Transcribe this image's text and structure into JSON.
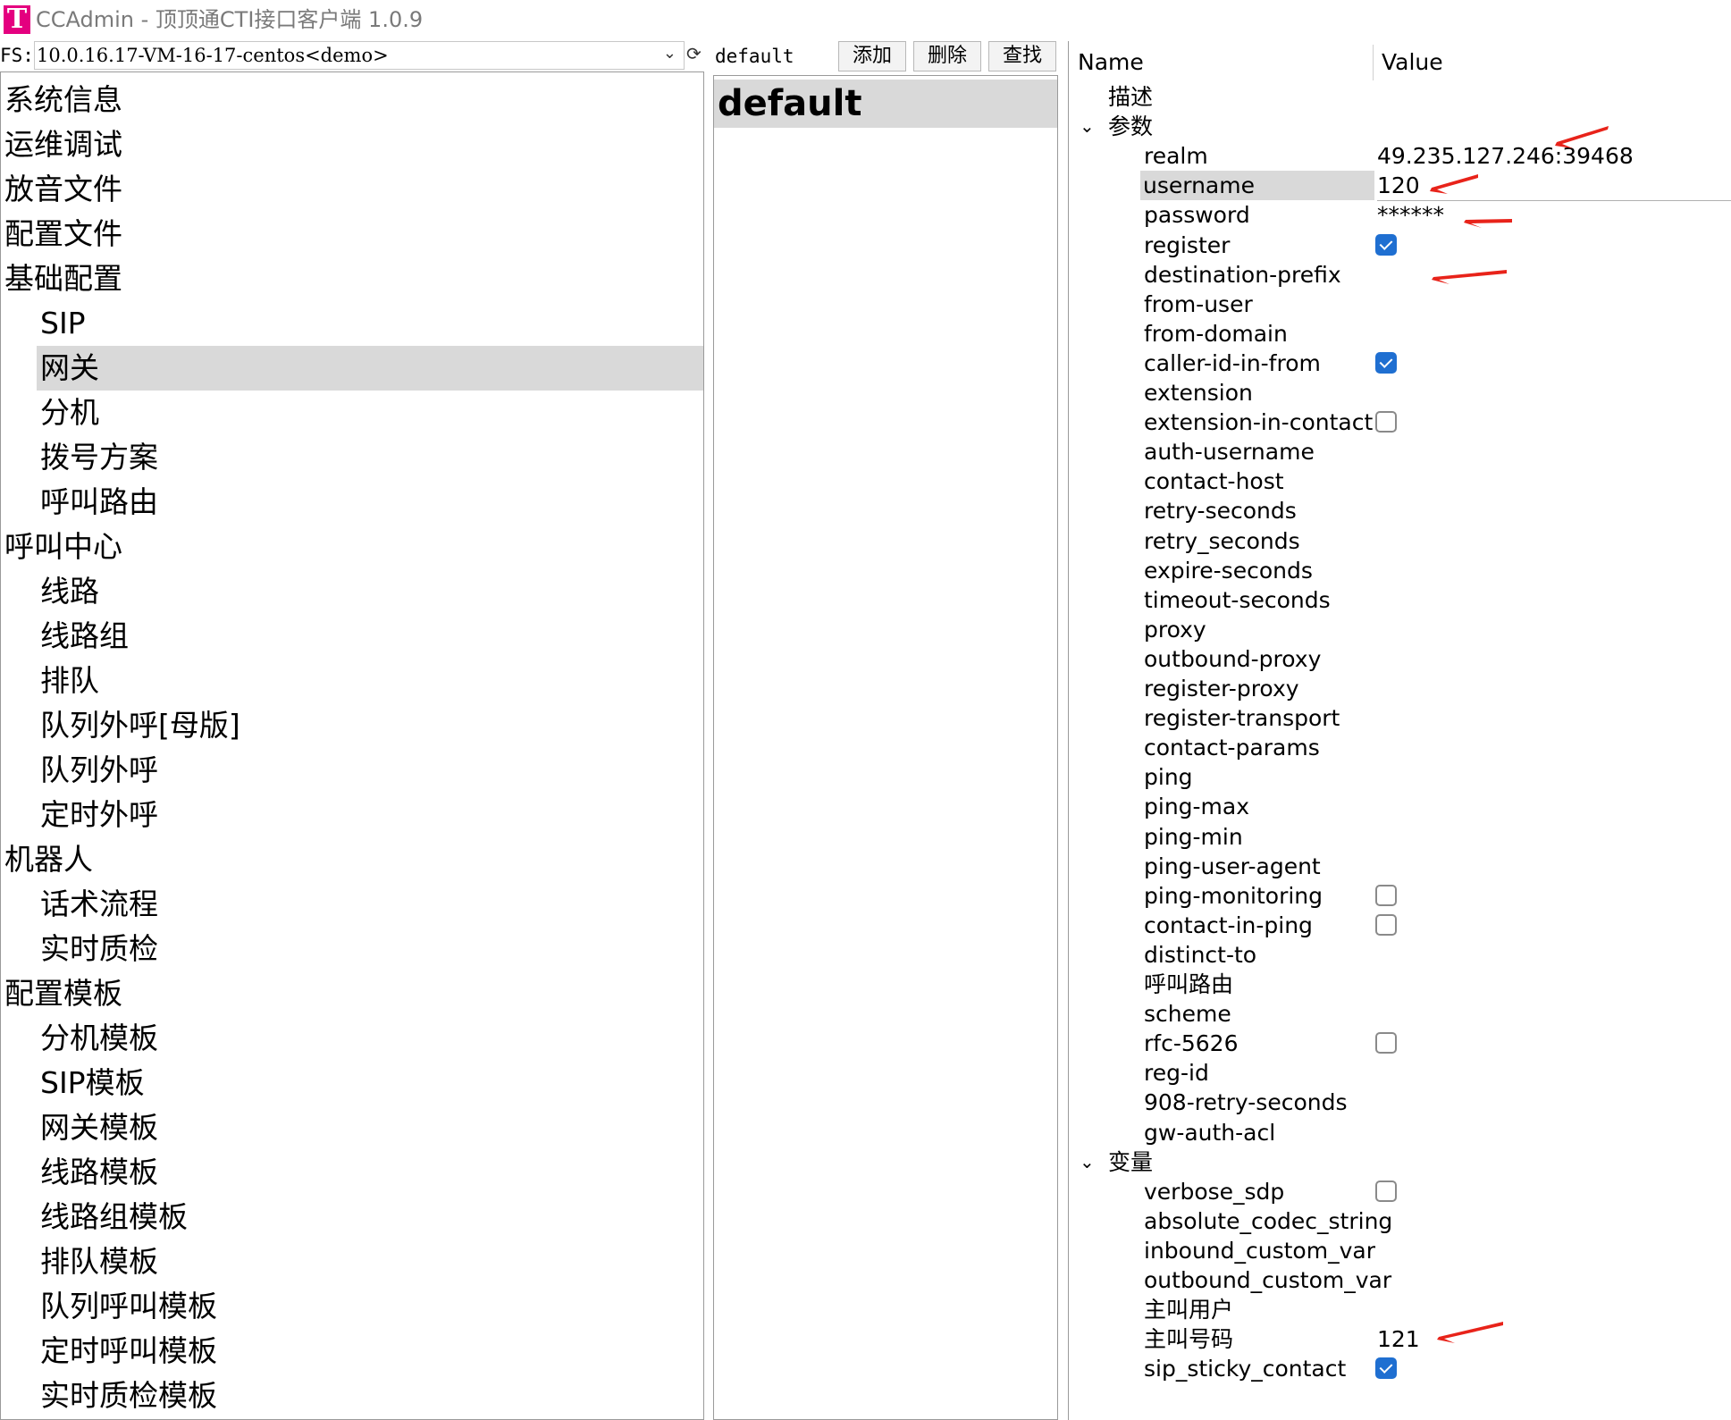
{
  "window": {
    "logo_letter": "T",
    "title": "CCAdmin - 顶顶通CTI接口客户端 1.0.9"
  },
  "fs": {
    "label": "FS:",
    "value": "10.0.16.17-VM-16-17-centos<demo>"
  },
  "toolbar": {
    "filter_value": "default",
    "add_label": "添加",
    "delete_label": "删除",
    "find_label": "查找"
  },
  "tree": {
    "items": [
      {
        "label": "系统信息",
        "level": 0
      },
      {
        "label": "运维调试",
        "level": 0
      },
      {
        "label": "放音文件",
        "level": 0
      },
      {
        "label": "配置文件",
        "level": 0
      },
      {
        "label": "基础配置",
        "level": 0
      },
      {
        "label": "SIP",
        "level": 1
      },
      {
        "label": "网关",
        "level": 1,
        "selected": true
      },
      {
        "label": "分机",
        "level": 1
      },
      {
        "label": "拨号方案",
        "level": 1
      },
      {
        "label": "呼叫路由",
        "level": 1
      },
      {
        "label": "呼叫中心",
        "level": 0
      },
      {
        "label": "线路",
        "level": 1
      },
      {
        "label": "线路组",
        "level": 1
      },
      {
        "label": "排队",
        "level": 1
      },
      {
        "label": "队列外呼[母版]",
        "level": 1
      },
      {
        "label": "队列外呼",
        "level": 1
      },
      {
        "label": "定时外呼",
        "level": 1
      },
      {
        "label": "机器人",
        "level": 0
      },
      {
        "label": "话术流程",
        "level": 1
      },
      {
        "label": "实时质检",
        "level": 1
      },
      {
        "label": "配置模板",
        "level": 0
      },
      {
        "label": "分机模板",
        "level": 1
      },
      {
        "label": "SIP模板",
        "level": 1
      },
      {
        "label": "网关模板",
        "level": 1
      },
      {
        "label": "线路模板",
        "level": 1
      },
      {
        "label": "线路组模板",
        "level": 1
      },
      {
        "label": "排队模板",
        "level": 1
      },
      {
        "label": "队列呼叫模板",
        "level": 1
      },
      {
        "label": "定时呼叫模板",
        "level": 1
      },
      {
        "label": "实时质检模板",
        "level": 1
      }
    ]
  },
  "list": {
    "items": [
      {
        "label": "default",
        "selected": true
      }
    ]
  },
  "grid": {
    "col_name": "Name",
    "col_value": "Value",
    "rows": [
      {
        "name": "描述",
        "indent": 1
      },
      {
        "name": "参数",
        "indent": 1,
        "group": true
      },
      {
        "name": "realm",
        "indent": 2,
        "value": "49.235.127.246:39468"
      },
      {
        "name": "username",
        "indent": 2,
        "value": "120",
        "selected": true
      },
      {
        "name": "password",
        "indent": 2,
        "value": "******"
      },
      {
        "name": "register",
        "indent": 2,
        "checkbox": true,
        "checked": true
      },
      {
        "name": "destination-prefix",
        "indent": 2
      },
      {
        "name": "from-user",
        "indent": 2
      },
      {
        "name": "from-domain",
        "indent": 2
      },
      {
        "name": "caller-id-in-from",
        "indent": 2,
        "checkbox": true,
        "checked": true
      },
      {
        "name": "extension",
        "indent": 2
      },
      {
        "name": "extension-in-contact",
        "indent": 2,
        "checkbox": true,
        "checked": false
      },
      {
        "name": "auth-username",
        "indent": 2
      },
      {
        "name": "contact-host",
        "indent": 2
      },
      {
        "name": "retry-seconds",
        "indent": 2
      },
      {
        "name": "retry_seconds",
        "indent": 2
      },
      {
        "name": "expire-seconds",
        "indent": 2
      },
      {
        "name": "timeout-seconds",
        "indent": 2
      },
      {
        "name": "proxy",
        "indent": 2
      },
      {
        "name": "outbound-proxy",
        "indent": 2
      },
      {
        "name": "register-proxy",
        "indent": 2
      },
      {
        "name": "register-transport",
        "indent": 2
      },
      {
        "name": "contact-params",
        "indent": 2
      },
      {
        "name": "ping",
        "indent": 2
      },
      {
        "name": "ping-max",
        "indent": 2
      },
      {
        "name": "ping-min",
        "indent": 2
      },
      {
        "name": "ping-user-agent",
        "indent": 2
      },
      {
        "name": "ping-monitoring",
        "indent": 2,
        "checkbox": true,
        "checked": false
      },
      {
        "name": "contact-in-ping",
        "indent": 2,
        "checkbox": true,
        "checked": false
      },
      {
        "name": "distinct-to",
        "indent": 2
      },
      {
        "name": "呼叫路由",
        "indent": 2
      },
      {
        "name": "scheme",
        "indent": 2
      },
      {
        "name": "rfc-5626",
        "indent": 2,
        "checkbox": true,
        "checked": false
      },
      {
        "name": "reg-id",
        "indent": 2
      },
      {
        "name": "908-retry-seconds",
        "indent": 2
      },
      {
        "name": "gw-auth-acl",
        "indent": 2
      },
      {
        "name": "变量",
        "indent": 1,
        "group": true
      },
      {
        "name": "verbose_sdp",
        "indent": 2,
        "checkbox": true,
        "checked": false
      },
      {
        "name": "absolute_codec_string",
        "indent": 2
      },
      {
        "name": "inbound_custom_var",
        "indent": 2
      },
      {
        "name": "outbound_custom_var",
        "indent": 2
      },
      {
        "name": "主叫用户",
        "indent": 2
      },
      {
        "name": "主叫号码",
        "indent": 2,
        "value": "121"
      },
      {
        "name": "sip_sticky_contact",
        "indent": 2,
        "checkbox": true,
        "checked": true
      }
    ]
  },
  "icons": {
    "dropdown": "chevron-down-icon",
    "refresh": "refresh-icon",
    "expand": "chevron-down-icon"
  },
  "colors": {
    "logo": "#e4007f",
    "checkbox": "#1f6fd1",
    "annotation_arrow": "#e8231a",
    "selection": "#d9d9d9"
  }
}
